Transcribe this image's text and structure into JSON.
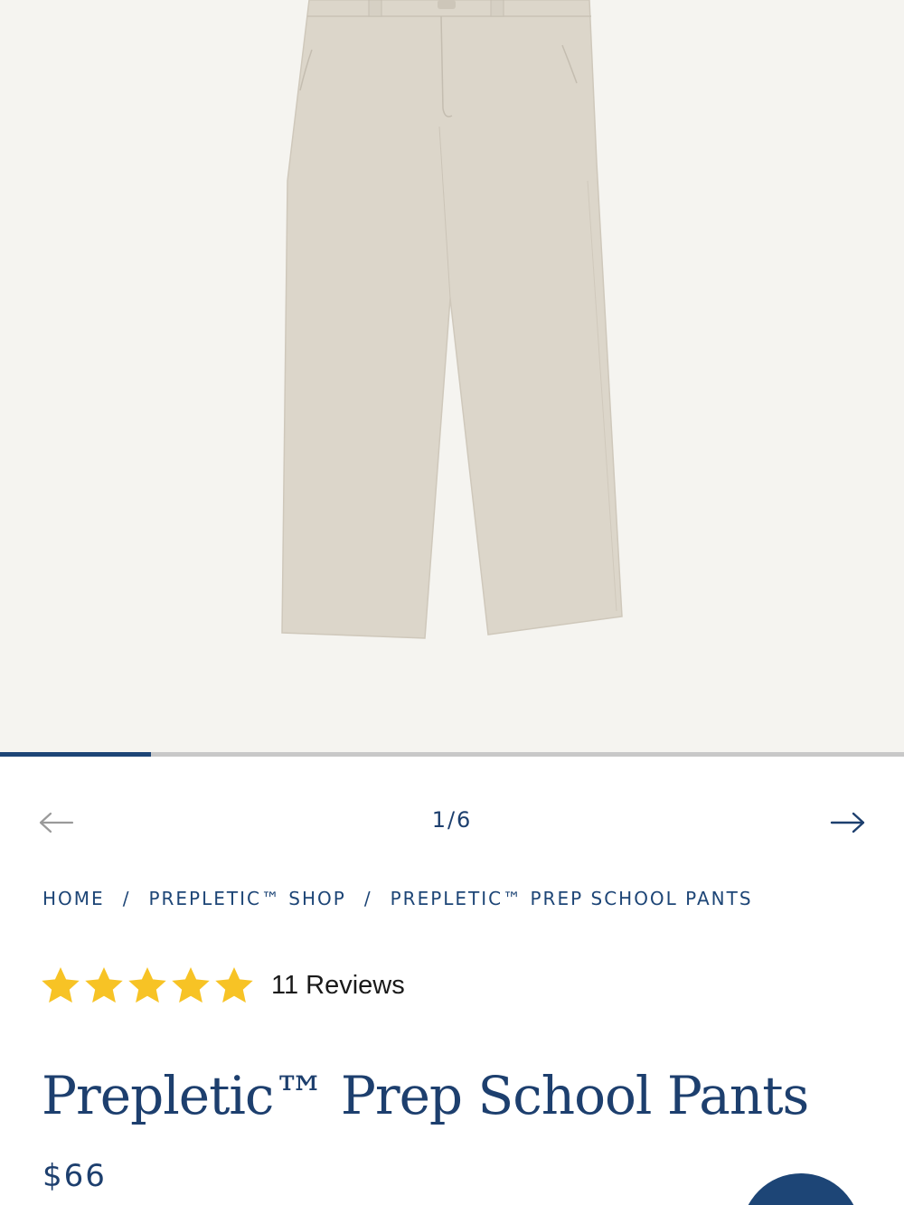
{
  "gallery": {
    "image_alt": "Prepletic™ Prep School Pants",
    "current_slide": 1,
    "total_slides": 6,
    "counter": "1/6",
    "progress_fraction": 0.1667,
    "prev_icon": "arrow-left-icon",
    "next_icon": "arrow-right-icon"
  },
  "breadcrumb": {
    "items": [
      "HOME",
      "PREPLETIC™ SHOP",
      "PREPLETIC™ PREP SCHOOL PANTS"
    ],
    "separator": "/"
  },
  "rating": {
    "stars": 5,
    "max_stars": 5,
    "reviews_label": "11 Reviews",
    "star_color": "#f7c325"
  },
  "product": {
    "title": "Prepletic™ Prep School Pants",
    "price": "$66"
  },
  "colors": {
    "brand_navy": "#1d4576",
    "gallery_background": "#f5f4f0",
    "pants_khaki": "#dcd6ca"
  },
  "chat": {
    "icon": "chat-icon"
  }
}
